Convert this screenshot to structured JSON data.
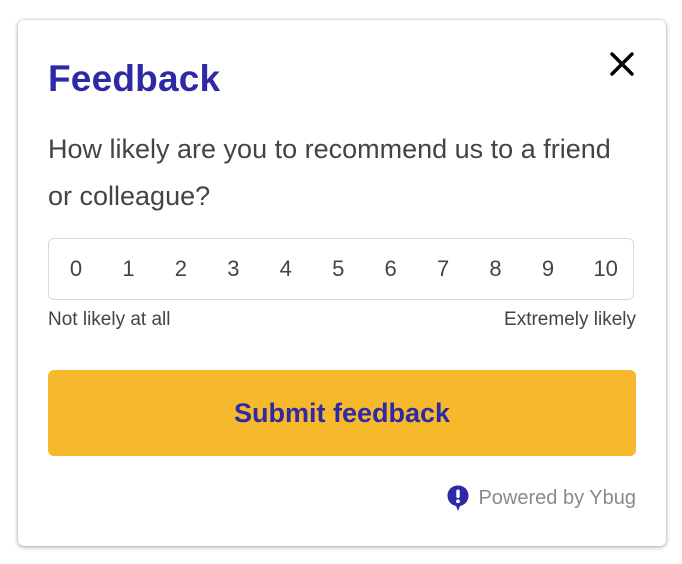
{
  "widget": {
    "title": "Feedback",
    "close_icon": "close-icon",
    "question": "How likely are you to recommend us to a friend or colleague?",
    "scale": [
      "0",
      "1",
      "2",
      "3",
      "4",
      "5",
      "6",
      "7",
      "8",
      "9",
      "10"
    ],
    "label_low": "Not likely at all",
    "label_high": "Extremely likely",
    "submit_label": "Submit feedback",
    "powered_icon": "ybug-logo-icon",
    "powered_by": "Powered by Ybug"
  },
  "colors": {
    "accent": "#2e2aa6",
    "button": "#f6b92b",
    "text": "#444444",
    "muted": "#8a8a8a",
    "border": "#d9d9d9"
  }
}
